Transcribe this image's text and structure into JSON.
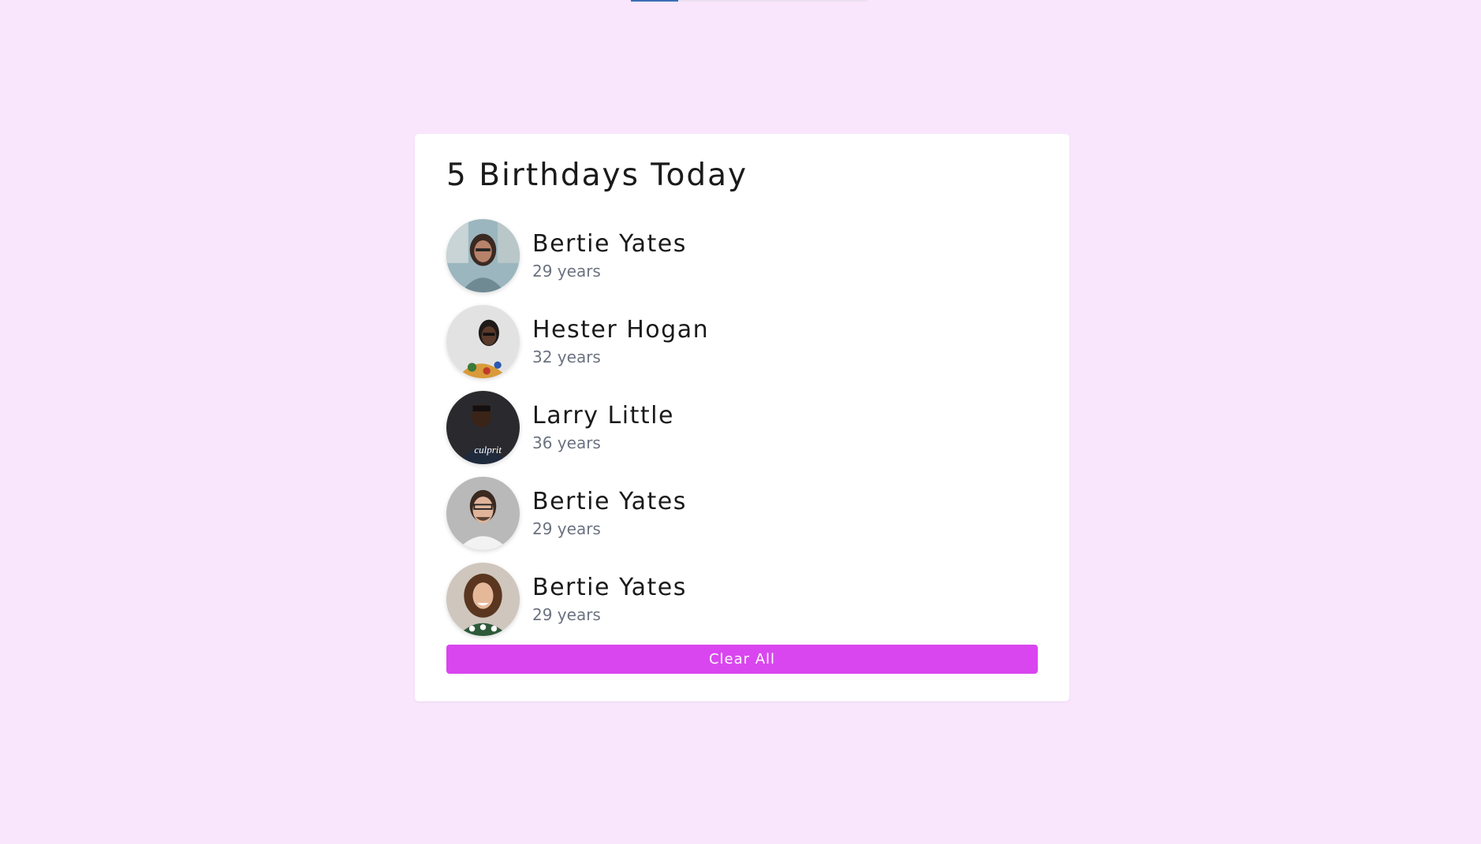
{
  "title": "5 Birthdays Today",
  "people": [
    {
      "name": "Bertie Yates",
      "age": "29 years",
      "avatar_icon": "person-photo-avatar"
    },
    {
      "name": "Hester Hogan",
      "age": "32 years",
      "avatar_icon": "person-photo-avatar"
    },
    {
      "name": "Larry Little",
      "age": "36 years",
      "avatar_icon": "person-photo-avatar"
    },
    {
      "name": "Bertie Yates",
      "age": "29 years",
      "avatar_icon": "person-photo-avatar"
    },
    {
      "name": "Bertie Yates",
      "age": "29 years",
      "avatar_icon": "person-photo-avatar"
    }
  ],
  "clear_button": "Clear All",
  "colors": {
    "background": "#f9e6fd",
    "button": "#d946ef",
    "card": "#ffffff",
    "age_text": "#6b7280"
  }
}
